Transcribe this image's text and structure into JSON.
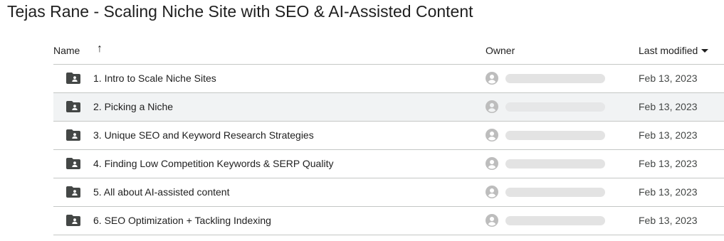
{
  "title": "Tejas Rane - Scaling Niche Site with SEO & AI-Assisted Content",
  "header": {
    "name_label": "Name",
    "sort_arrow": "↑",
    "owner_label": "Owner",
    "modified_label": "Last modified"
  },
  "icons": {
    "folder": "folder-shared-icon",
    "avatar": "account-circle-icon",
    "sort": "arrow-up-icon",
    "dropdown": "caret-down-icon"
  },
  "colors": {
    "text": "#1f1f1f",
    "muted": "#444746",
    "icon": "#444746",
    "divider": "#c4c7c5",
    "hover_row": "#f1f3f4",
    "placeholder": "#e3e3e3"
  },
  "rows": [
    {
      "name": "1. Intro to Scale Niche Sites",
      "modified": "Feb 13, 2023"
    },
    {
      "name": "2. Picking a Niche",
      "modified": "Feb 13, 2023"
    },
    {
      "name": "3. Unique SEO and Keyword Research Strategies",
      "modified": "Feb 13, 2023"
    },
    {
      "name": "4. Finding Low Competition Keywords & SERP Quality",
      "modified": "Feb 13, 2023"
    },
    {
      "name": "5. All about AI-assisted content",
      "modified": "Feb 13, 2023"
    },
    {
      "name": "6. SEO Optimization + Tackling Indexing",
      "modified": "Feb 13, 2023"
    }
  ]
}
